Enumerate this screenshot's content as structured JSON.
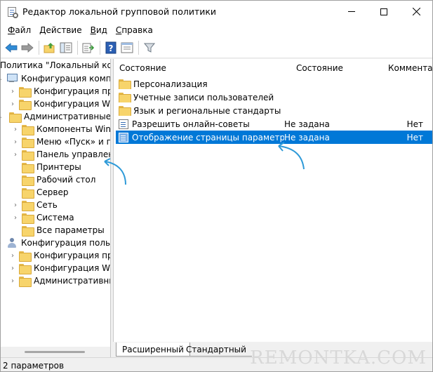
{
  "window": {
    "title": "Редактор локальной групповой политики"
  },
  "menubar": [
    {
      "label": "Файл",
      "accel": "Ф",
      "rest": "айл"
    },
    {
      "label": "Действие",
      "accel": "Д",
      "rest": "ействие"
    },
    {
      "label": "Вид",
      "accel": "В",
      "rest": "ид"
    },
    {
      "label": "Справка",
      "accel": "С",
      "rest": "правка"
    }
  ],
  "tree": {
    "root": "Политика \"Локальный компьютер\"",
    "computer_config": "Конфигурация компьютера",
    "cc_programs": "Конфигурация программ",
    "cc_windows": "Конфигурация Windows",
    "cc_admin": "Административные шаблоны",
    "components": "Компоненты Windows",
    "start_menu": "Меню «Пуск» и панель задач",
    "control_panel": "Панель управления",
    "printers": "Принтеры",
    "desktop": "Рабочий стол",
    "server": "Сервер",
    "network": "Сеть",
    "system": "Система",
    "all_settings": "Все параметры",
    "user_config": "Конфигурация пользователя",
    "uc_programs": "Конфигурация программ",
    "uc_windows": "Конфигурация Windows",
    "uc_admin": "Административные шаблоны"
  },
  "list": {
    "headers": {
      "name": "Состояние",
      "state": "Состояние",
      "comment": "Комментарий"
    },
    "folders": [
      "Персонализация",
      "Учетные записи пользователей",
      "Язык и региональные стандарты"
    ],
    "settings": [
      {
        "name": "Разрешить онлайн-советы",
        "state": "Не задана",
        "comment": "Нет"
      },
      {
        "name": "Отображение страницы параметров",
        "state": "Не задана",
        "comment": "Нет"
      }
    ]
  },
  "tabs": {
    "extended": "Расширенный",
    "standard": "Стандартный"
  },
  "status": "2 параметров",
  "watermark": "REMONTKA.COM",
  "colors": {
    "selection": "#0078d7",
    "arrow": "#2e9ad8",
    "folder": "#f7d46b"
  }
}
